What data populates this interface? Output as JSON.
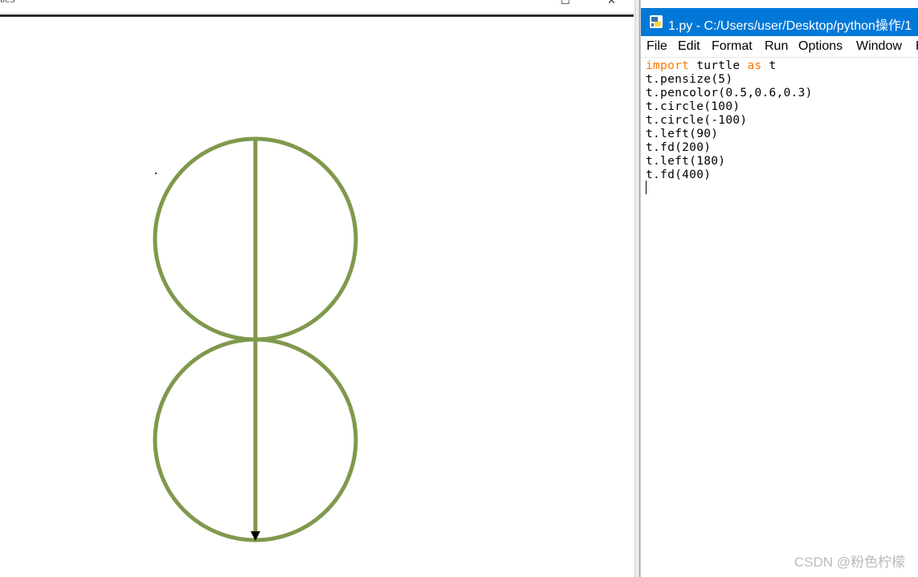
{
  "turtle_window": {
    "title": "tles",
    "pen_color": "#7f994c"
  },
  "editor_window": {
    "title": "1.py - C:/Users/user/Desktop/python操作/1",
    "menu": [
      "File",
      "Edit",
      "Format",
      "Run",
      "Options",
      "Window",
      "H"
    ],
    "code_lines": [
      [
        {
          "text": "import",
          "kw": true
        },
        {
          "text": " turtle ",
          "kw": false
        },
        {
          "text": "as",
          "kw": true
        },
        {
          "text": " t",
          "kw": false
        }
      ],
      [
        {
          "text": "t.pensize(5)",
          "kw": false
        }
      ],
      [
        {
          "text": "t.pencolor(0.5,0.6,0.3)",
          "kw": false
        }
      ],
      [
        {
          "text": "t.circle(100)",
          "kw": false
        }
      ],
      [
        {
          "text": "t.circle(-100)",
          "kw": false
        }
      ],
      [
        {
          "text": "t.left(90)",
          "kw": false
        }
      ],
      [
        {
          "text": "t.fd(200)",
          "kw": false
        }
      ],
      [
        {
          "text": "t.left(180)",
          "kw": false
        }
      ],
      [
        {
          "text": "t.fd(400)",
          "kw": false
        }
      ]
    ]
  },
  "watermark": "CSDN @粉色柠檬"
}
